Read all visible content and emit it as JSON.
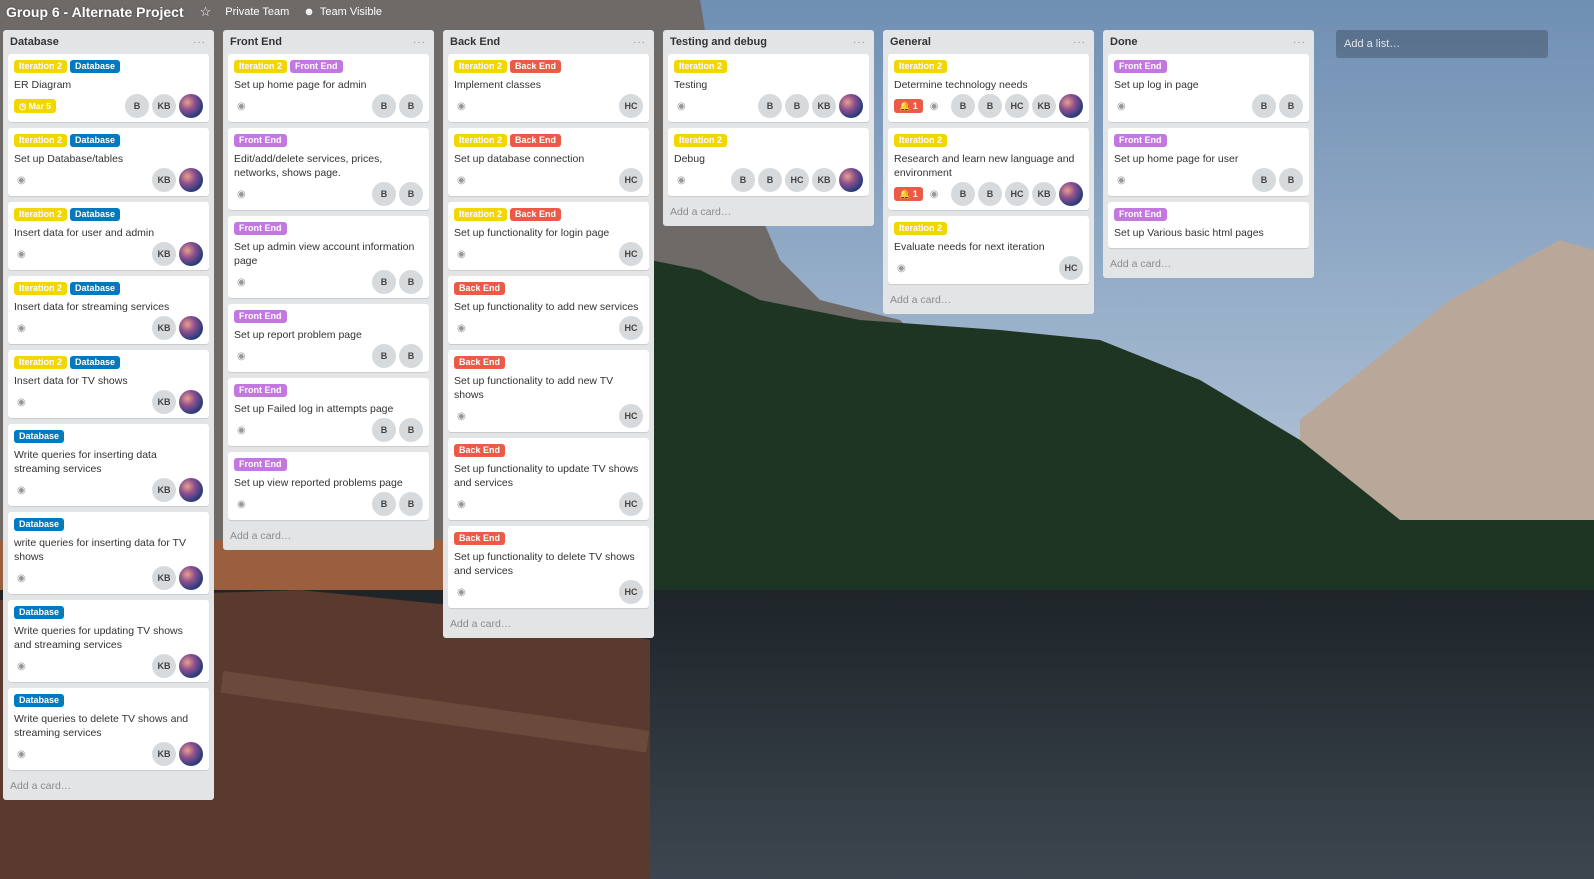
{
  "header": {
    "board_title": "Group 6 - Alternate Project",
    "private_team": "Private Team",
    "team_visible": "Team Visible"
  },
  "colors": {
    "iteration": "#f2d600",
    "database": "#0079bf",
    "front_end": "#c377e0",
    "back_end": "#eb5a46"
  },
  "add_list": "Add a list…",
  "add_card": "Add a card…",
  "lists": [
    {
      "title": "Database",
      "cards": [
        {
          "labels": [
            "Iteration 2",
            "Database"
          ],
          "title": "ER Diagram",
          "due": "Mar 5",
          "members": [
            "B",
            "KB"
          ]
        },
        {
          "labels": [
            "Iteration 2",
            "Database"
          ],
          "title": "Set up Database/tables",
          "members": [
            "KB"
          ]
        },
        {
          "labels": [
            "Iteration 2",
            "Database"
          ],
          "title": "Insert data for user and admin",
          "members": [
            "KB"
          ]
        },
        {
          "labels": [
            "Iteration 2",
            "Database"
          ],
          "title": "Insert data for streaming services",
          "members": [
            "KB"
          ]
        },
        {
          "labels": [
            "Iteration 2",
            "Database"
          ],
          "title": "Insert data for TV shows",
          "members": [
            "KB"
          ]
        },
        {
          "labels": [
            "Database"
          ],
          "title": "Write queries for inserting data streaming services",
          "members": [
            "KB"
          ]
        },
        {
          "labels": [
            "Database"
          ],
          "title": "write queries for inserting data for TV shows",
          "members": [
            "KB"
          ]
        },
        {
          "labels": [
            "Database"
          ],
          "title": "Write queries for updating TV shows and streaming services",
          "members": [
            "KB"
          ]
        },
        {
          "labels": [
            "Database"
          ],
          "title": "Write queries to delete TV shows and streaming services",
          "members": [
            "KB"
          ]
        }
      ]
    },
    {
      "title": "Front End",
      "cards": [
        {
          "labels": [
            "Iteration 2",
            "Front End"
          ],
          "title": "Set up home page for admin",
          "members": [
            "B",
            "B"
          ]
        },
        {
          "labels": [
            "Front End"
          ],
          "title": "Edit/add/delete services, prices, networks, shows page.",
          "members": [
            "B",
            "B"
          ]
        },
        {
          "labels": [
            "Front End"
          ],
          "title": "Set up admin view account information page",
          "members": [
            "B",
            "B"
          ]
        },
        {
          "labels": [
            "Front End"
          ],
          "title": "Set up report problem page",
          "members": [
            "B",
            "B"
          ]
        },
        {
          "labels": [
            "Front End"
          ],
          "title": "Set up Failed log in attempts page",
          "members": [
            "B",
            "B"
          ]
        },
        {
          "labels": [
            "Front End"
          ],
          "title": "Set up view reported problems page",
          "members": [
            "B",
            "B"
          ]
        }
      ]
    },
    {
      "title": "Back End",
      "cards": [
        {
          "labels": [
            "Iteration 2",
            "Back End"
          ],
          "title": "Implement classes",
          "members": [
            "HC"
          ]
        },
        {
          "labels": [
            "Iteration 2",
            "Back End"
          ],
          "title": "Set up database connection",
          "members": [
            "HC"
          ]
        },
        {
          "labels": [
            "Iteration 2",
            "Back End"
          ],
          "title": "Set up functionality for login page",
          "members": [
            "HC"
          ]
        },
        {
          "labels": [
            "Back End"
          ],
          "title": "Set up functionality to add new services",
          "members": [
            "HC"
          ]
        },
        {
          "labels": [
            "Back End"
          ],
          "title": "Set up functionality to add new TV shows",
          "members": [
            "HC"
          ]
        },
        {
          "labels": [
            "Back End"
          ],
          "title": "Set up functionality to update TV shows and services",
          "members": [
            "HC"
          ]
        },
        {
          "labels": [
            "Back End"
          ],
          "title": "Set up functionality to delete TV shows and services",
          "members": [
            "HC"
          ]
        }
      ]
    },
    {
      "title": "Testing and debug",
      "cards": [
        {
          "labels": [
            "Iteration 2"
          ],
          "title": "Testing",
          "members": [
            "B",
            "B",
            "KB"
          ]
        },
        {
          "labels": [
            "Iteration 2"
          ],
          "title": "Debug",
          "members": [
            "B",
            "B",
            "HC",
            "KB"
          ]
        }
      ]
    },
    {
      "title": "General",
      "cards": [
        {
          "labels": [
            "Iteration 2"
          ],
          "title": "Determine technology needs",
          "alert": "1",
          "members": [
            "B",
            "B",
            "HC",
            "KB"
          ]
        },
        {
          "labels": [
            "Iteration 2"
          ],
          "title": "Research and learn new language and environment",
          "alert": "1",
          "members": [
            "B",
            "B",
            "HC",
            "KB"
          ]
        },
        {
          "labels": [
            "Iteration 2"
          ],
          "title": "Evaluate needs for next iteration",
          "members": [
            "HC"
          ]
        }
      ]
    },
    {
      "title": "Done",
      "cards": [
        {
          "labels": [
            "Front End"
          ],
          "title": "Set up log in page",
          "members": [
            "B",
            "B"
          ]
        },
        {
          "labels": [
            "Front End"
          ],
          "title": "Set up home page for user",
          "members": [
            "B",
            "B"
          ]
        },
        {
          "labels": [
            "Front End"
          ],
          "title": "Set up Various basic html pages"
        }
      ]
    }
  ]
}
